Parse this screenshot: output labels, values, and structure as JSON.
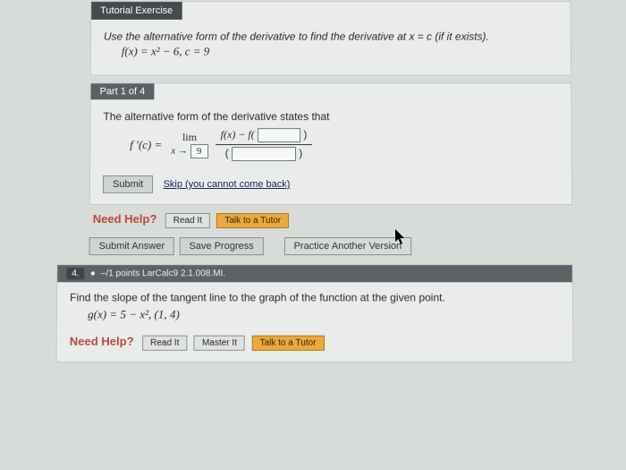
{
  "tutorial": {
    "tab_label": "Tutorial Exercise",
    "instruction": "Use the alternative form of the derivative to find the derivative at x = c (if it exists).",
    "formula": "f(x) = x² − 6,  c = 9"
  },
  "part1": {
    "tab_label": "Part 1 of 4",
    "statement": "The alternative form of the derivative states that",
    "fprime_label": "f ′(c) =",
    "lim_label": "lim",
    "arrow_label": "x →",
    "c_value": "9",
    "num_prefix": "f(x) − f(",
    "num_suffix": ")",
    "den_prefix": "(",
    "den_suffix": ")",
    "submit": "Submit",
    "skip": "Skip (you cannot come back)"
  },
  "help1": {
    "label": "Need Help?",
    "read": "Read It",
    "talk": "Talk to a Tutor"
  },
  "actions": {
    "submit_answer": "Submit Answer",
    "save_progress": "Save Progress",
    "practice": "Practice Another Version"
  },
  "q4": {
    "number": "4.",
    "points": "–/1 points  LarCalc9 2.1.008.MI.",
    "prompt": "Find the slope of the tangent line to the graph of the function at the given point.",
    "formula": "g(x) = 5 − x²,   (1, 4)"
  },
  "help2": {
    "label": "Need Help?",
    "read": "Read It",
    "master": "Master It",
    "talk": "Talk to a Tutor"
  }
}
